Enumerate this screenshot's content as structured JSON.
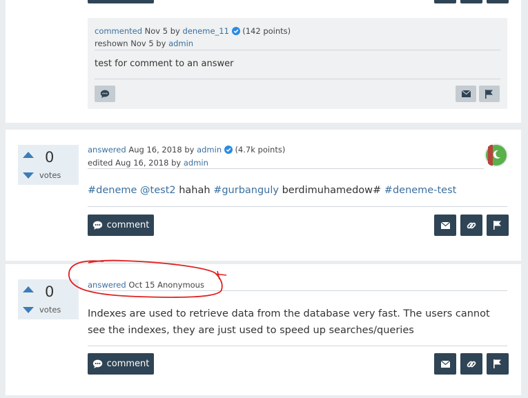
{
  "comment": {
    "action": "commented",
    "date": "Nov 5",
    "by": "by",
    "user": "deneme_11",
    "points": "(142 points)",
    "reshown_prefix": "reshown Nov 5 by",
    "reshown_user": "admin",
    "body": "test for comment to an answer"
  },
  "answer1": {
    "votes": "0",
    "votes_label": "votes",
    "action": "answered",
    "date": "Aug 16, 2018",
    "by": "by",
    "user": "admin",
    "points": "(4.7k points)",
    "edited_prefix": "edited Aug 16, 2018 by",
    "edited_user": "admin",
    "tag1": "#deneme",
    "tag2": "@test2",
    "text1": "hahah",
    "tag3": "#gurbanguly",
    "text2": "berdimuhamedow#",
    "tag4": "#deneme-test",
    "comment_button": "comment"
  },
  "answer2": {
    "votes": "0",
    "votes_label": "votes",
    "action": "answered",
    "meta_rest": "Oct 15 Anonymous",
    "body": "Indexes are used to retrieve data from the database very fast. The users cannot see the indexes, they are just used to speed up searches/queries",
    "comment_button": "comment"
  },
  "colors": {
    "accent": "#3b6fa0",
    "dark_button": "#2f4455",
    "annotation": "#e02020"
  }
}
